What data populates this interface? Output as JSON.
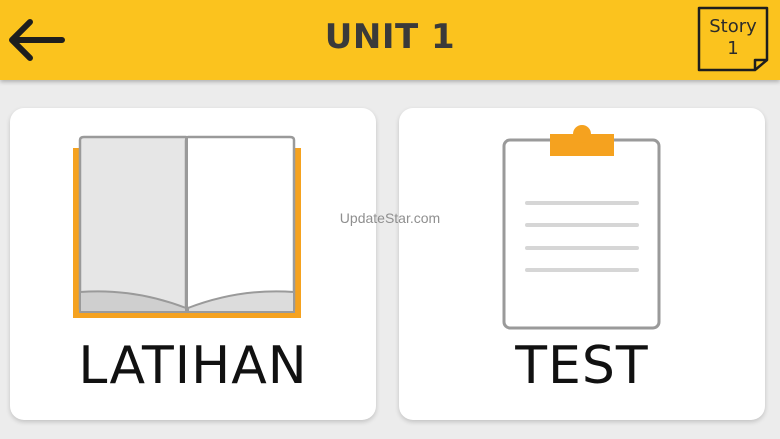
{
  "header": {
    "title": "UNIT 1",
    "back_icon": "arrow-left-icon",
    "story": {
      "line1": "Story",
      "line2": "1",
      "icon": "folded-page-icon"
    }
  },
  "cards": [
    {
      "label": "LATIHAN",
      "icon": "open-book-icon"
    },
    {
      "label": "TEST",
      "icon": "clipboard-icon"
    }
  ],
  "watermark": "UpdateStar.com",
  "colors": {
    "header_bg": "#fbc31e",
    "accent_orange": "#f5a21f",
    "background": "#ececec",
    "card_bg": "#ffffff",
    "title_text": "#3a3a3a"
  }
}
